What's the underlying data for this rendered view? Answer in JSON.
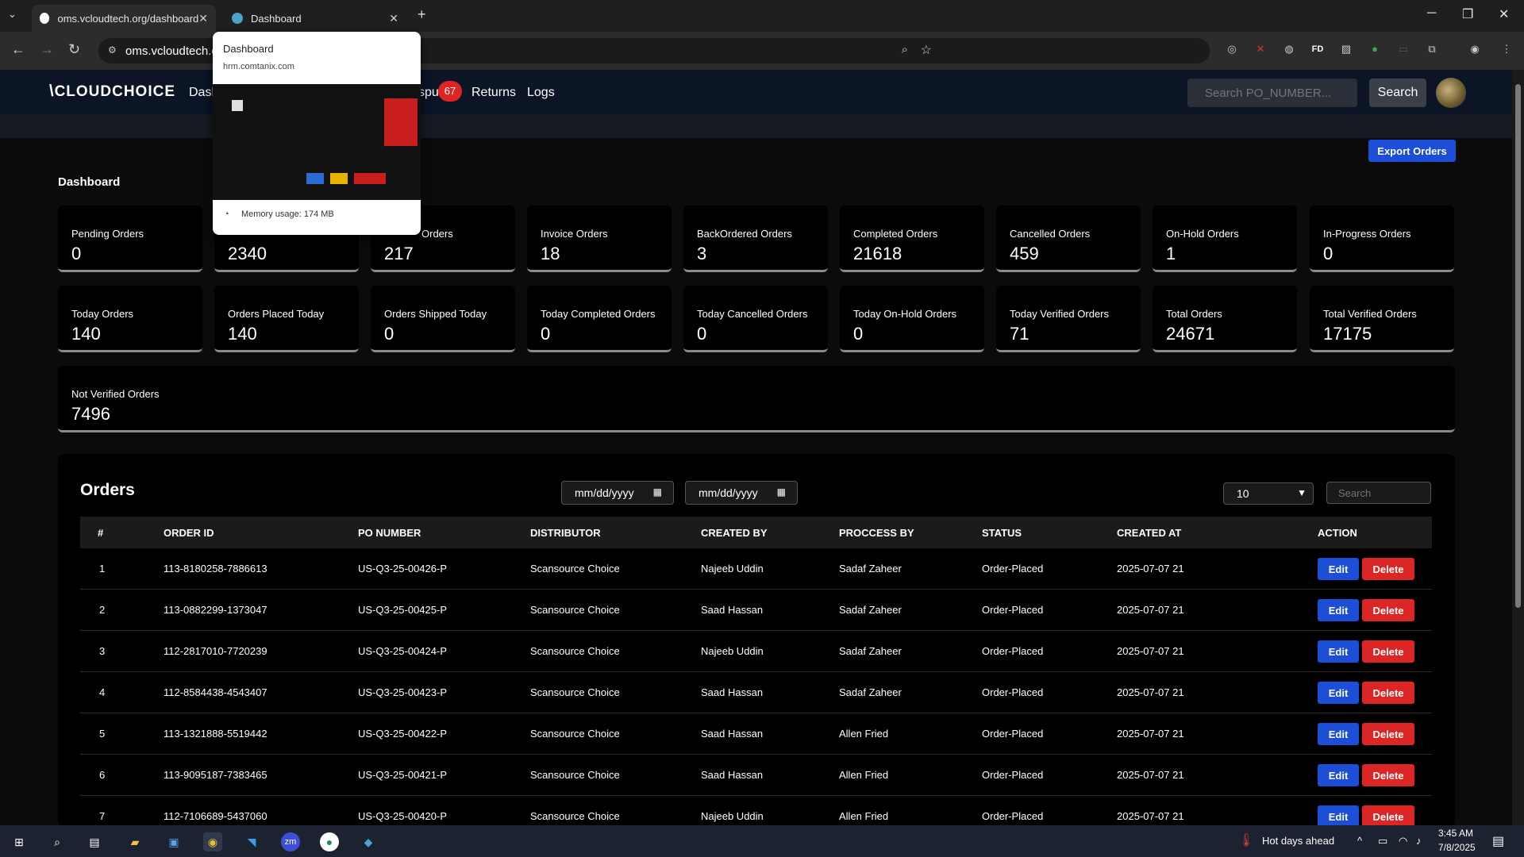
{
  "browser": {
    "tabs": [
      {
        "label": "oms.vcloudtech.org/dashboard",
        "active": true
      },
      {
        "label": "Dashboard",
        "active": false
      }
    ],
    "address": "oms.vcloudtech.o",
    "preview": {
      "title": "Dashboard",
      "url": "hrm.comtanix.com",
      "memory": "Memory usage: 174 MB"
    },
    "extensions": [
      "glasses-icon",
      "close-red-icon",
      "globe-icon",
      "fd-icon",
      "image-icon",
      "shield-icon",
      "screen-icon",
      "puzzle-icon",
      "profile-icon",
      "menu-icon"
    ],
    "ext_fd": "FD"
  },
  "app": {
    "logo": "CLOUDCHOICE",
    "nav": {
      "dashboard": "Dash",
      "disputes": "spu",
      "disputes_badge": "67",
      "returns": "Returns",
      "logs": "Logs"
    },
    "search_placeholder": "Search PO_NUMBER...",
    "search_btn": "Search",
    "export_btn": "Export Orders",
    "dashboard_title": "Dashboard"
  },
  "cards_row1": [
    {
      "label": "Pending Orders",
      "value": "0"
    },
    {
      "label": "",
      "value": "2340"
    },
    {
      "label": "Orders",
      "value": "217"
    },
    {
      "label": "Invoice Orders",
      "value": "18"
    },
    {
      "label": "BackOrdered Orders",
      "value": "3"
    },
    {
      "label": "Completed Orders",
      "value": "21618"
    },
    {
      "label": "Cancelled Orders",
      "value": "459"
    },
    {
      "label": "On-Hold Orders",
      "value": "1"
    },
    {
      "label": "In-Progress Orders",
      "value": "0"
    }
  ],
  "cards_row2": [
    {
      "label": "Today Orders",
      "value": "140"
    },
    {
      "label": "Orders Placed Today",
      "value": "140"
    },
    {
      "label": "Orders Shipped Today",
      "value": "0"
    },
    {
      "label": "Today Completed Orders",
      "value": "0"
    },
    {
      "label": "Today Cancelled Orders",
      "value": "0"
    },
    {
      "label": "Today On-Hold Orders",
      "value": "0"
    },
    {
      "label": "Today Verified Orders",
      "value": "71"
    },
    {
      "label": "Total Orders",
      "value": "24671"
    },
    {
      "label": "Total Verified Orders",
      "value": "17175"
    }
  ],
  "card_not_verified": {
    "label": "Not Verified Orders",
    "value": "7496"
  },
  "orders": {
    "title": "Orders",
    "date_from": "mm/dd/yyyy",
    "date_to": "mm/dd/yyyy",
    "per_page": "10",
    "search_placeholder": "Search",
    "headers": [
      "#",
      "ORDER ID",
      "PO NUMBER",
      "DISTRIBUTOR",
      "CREATED BY",
      "PROCCESS BY",
      "STATUS",
      "CREATED AT",
      "ACTION"
    ],
    "edit_label": "Edit",
    "delete_label": "Delete",
    "rows": [
      {
        "n": "1",
        "order_id": "113-8180258-7886613",
        "po": "US-Q3-25-00426-P",
        "distributor": "Scansource Choice",
        "created_by": "Najeeb Uddin",
        "process_by": "Sadaf Zaheer",
        "status": "Order-Placed",
        "created_at": "2025-07-07 21"
      },
      {
        "n": "2",
        "order_id": "113-0882299-1373047",
        "po": "US-Q3-25-00425-P",
        "distributor": "Scansource Choice",
        "created_by": "Saad Hassan",
        "process_by": "Sadaf Zaheer",
        "status": "Order-Placed",
        "created_at": "2025-07-07 21"
      },
      {
        "n": "3",
        "order_id": "112-2817010-7720239",
        "po": "US-Q3-25-00424-P",
        "distributor": "Scansource Choice",
        "created_by": "Najeeb Uddin",
        "process_by": "Sadaf Zaheer",
        "status": "Order-Placed",
        "created_at": "2025-07-07 21"
      },
      {
        "n": "4",
        "order_id": "112-8584438-4543407",
        "po": "US-Q3-25-00423-P",
        "distributor": "Scansource Choice",
        "created_by": "Saad Hassan",
        "process_by": "Sadaf Zaheer",
        "status": "Order-Placed",
        "created_at": "2025-07-07 21"
      },
      {
        "n": "5",
        "order_id": "113-1321888-5519442",
        "po": "US-Q3-25-00422-P",
        "distributor": "Scansource Choice",
        "created_by": "Saad Hassan",
        "process_by": "Allen Fried",
        "status": "Order-Placed",
        "created_at": "2025-07-07 21"
      },
      {
        "n": "6",
        "order_id": "113-9095187-7383465",
        "po": "US-Q3-25-00421-P",
        "distributor": "Scansource Choice",
        "created_by": "Saad Hassan",
        "process_by": "Allen Fried",
        "status": "Order-Placed",
        "created_at": "2025-07-07 21"
      },
      {
        "n": "7",
        "order_id": "112-7106689-5437060",
        "po": "US-Q3-25-00420-P",
        "distributor": "Scansource Choice",
        "created_by": "Najeeb Uddin",
        "process_by": "Allen Fried",
        "status": "Order-Placed",
        "created_at": "2025-07-07 21"
      }
    ]
  },
  "taskbar": {
    "weather": "Hot days ahead",
    "time": "3:45 AM",
    "date": "7/8/2025"
  },
  "colors": {
    "accent_blue": "#1d4ed8",
    "danger_red": "#dc2626",
    "nav_bg": "#0b1526"
  }
}
